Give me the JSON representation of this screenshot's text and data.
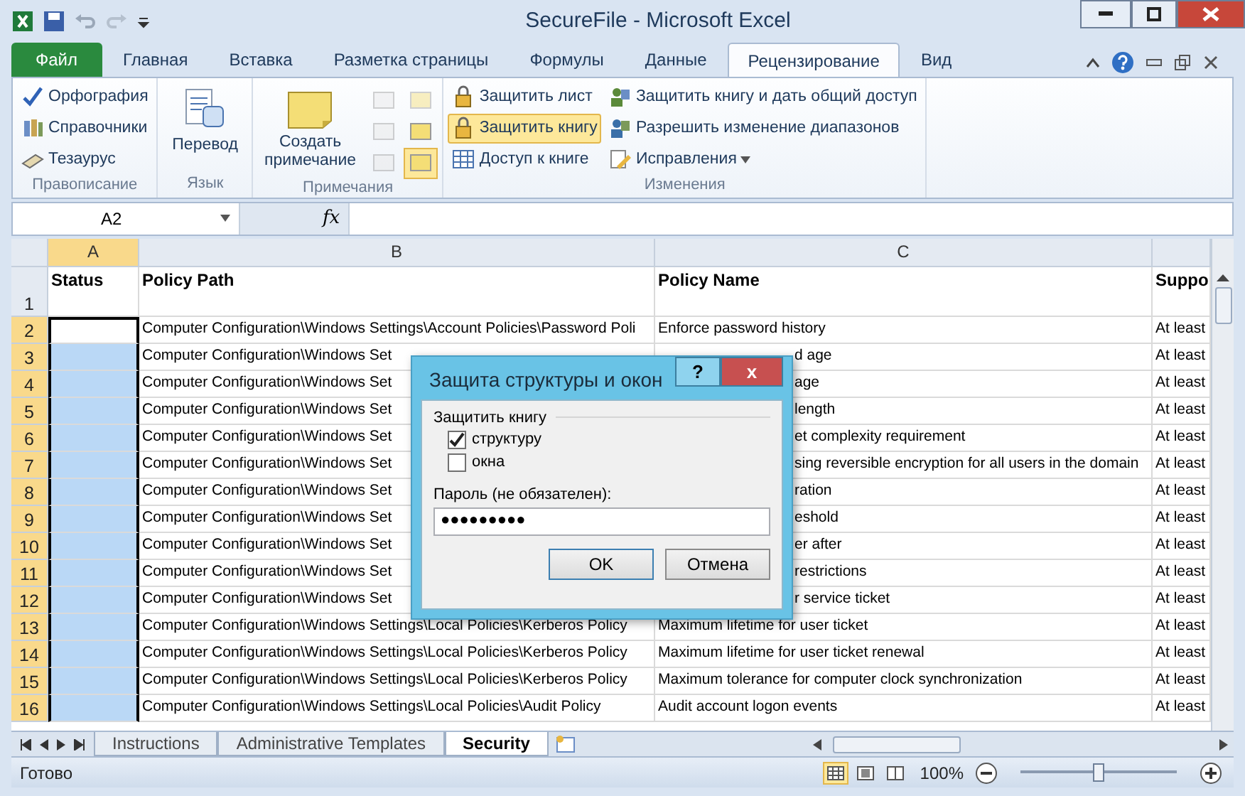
{
  "window": {
    "title": "SecureFile - Microsoft Excel"
  },
  "ribbon_tabs": [
    {
      "label": "Файл",
      "kind": "file",
      "selected": false
    },
    {
      "label": "Главная",
      "kind": "tab",
      "selected": false
    },
    {
      "label": "Вставка",
      "kind": "tab",
      "selected": false
    },
    {
      "label": "Разметка страницы",
      "kind": "tab",
      "selected": false
    },
    {
      "label": "Формулы",
      "kind": "tab",
      "selected": false
    },
    {
      "label": "Данные",
      "kind": "tab",
      "selected": false
    },
    {
      "label": "Рецензирование",
      "kind": "tab",
      "selected": true
    },
    {
      "label": "Вид",
      "kind": "tab",
      "selected": false
    }
  ],
  "ribbon_groups": [
    {
      "label": "Правописание",
      "kind": "list",
      "items": [
        {
          "label": "Орфография",
          "selected": false,
          "has_menu": false
        },
        {
          "label": "Справочники",
          "selected": false,
          "has_menu": false
        },
        {
          "label": "Тезаурус",
          "selected": false,
          "has_menu": false
        }
      ]
    },
    {
      "label": "Язык",
      "kind": "large",
      "items": [
        {
          "label": "Перевод",
          "selected": false,
          "has_menu": false
        }
      ]
    },
    {
      "label": "Примечания",
      "kind": "comments",
      "items": [
        {
          "label": "Создать примечание",
          "selected": false,
          "has_menu": false
        }
      ],
      "tools": [
        {
          "selected": false,
          "disabled": true
        },
        {
          "selected": false,
          "disabled": true
        },
        {
          "selected": false,
          "disabled": true
        },
        {
          "selected": false,
          "disabled": false
        },
        {
          "selected": false,
          "disabled": true
        },
        {
          "selected": true,
          "disabled": false
        }
      ]
    },
    {
      "label": "Изменения",
      "kind": "list",
      "items": [
        {
          "label": "Защитить лист",
          "selected": false,
          "has_menu": false
        },
        {
          "label": "Защитить книгу",
          "selected": true,
          "has_menu": false
        },
        {
          "label": "Доступ к книге",
          "selected": false,
          "has_menu": false
        },
        {
          "label": "Защитить книгу и дать общий доступ",
          "selected": false,
          "has_menu": false
        },
        {
          "label": "Разрешить изменение диапазонов",
          "selected": false,
          "has_menu": false
        },
        {
          "label": "Исправления",
          "selected": false,
          "has_menu": true
        }
      ]
    }
  ],
  "formula_bar": {
    "name_box": "A2",
    "function_label": "fx"
  },
  "columns": [
    {
      "label": "A",
      "selected": true
    },
    {
      "label": "B",
      "selected": false
    },
    {
      "label": "C",
      "selected": false
    }
  ],
  "header_row": {
    "number": "1",
    "selected": false,
    "status": "Status",
    "path": "Policy Path",
    "name": "Policy Name",
    "support": "Suppo"
  },
  "rows": [
    {
      "number": "2",
      "selected": true,
      "active": true,
      "obscured": false,
      "path": "Computer Configuration\\Windows Settings\\Account Policies\\Password Poli",
      "name": "Enforce password history",
      "support": "At least"
    },
    {
      "number": "3",
      "selected": true,
      "active": false,
      "obscured": true,
      "path": "Computer Configuration\\Windows Set",
      "name": "d age",
      "support": "At least"
    },
    {
      "number": "4",
      "selected": true,
      "active": false,
      "obscured": true,
      "path": "Computer Configuration\\Windows Set",
      "name": "age",
      "support": "At least"
    },
    {
      "number": "5",
      "selected": true,
      "active": false,
      "obscured": true,
      "path": "Computer Configuration\\Windows Set",
      "name": "length",
      "support": "At least"
    },
    {
      "number": "6",
      "selected": true,
      "active": false,
      "obscured": true,
      "path": "Computer Configuration\\Windows Set",
      "name": "et complexity requirement",
      "support": "At least"
    },
    {
      "number": "7",
      "selected": true,
      "active": false,
      "obscured": true,
      "path": "Computer Configuration\\Windows Set",
      "name": "sing reversible encryption for all users in the domain",
      "support": "At least"
    },
    {
      "number": "8",
      "selected": true,
      "active": false,
      "obscured": true,
      "path": "Computer Configuration\\Windows Set",
      "name": "ration",
      "support": "At least"
    },
    {
      "number": "9",
      "selected": true,
      "active": false,
      "obscured": true,
      "path": "Computer Configuration\\Windows Set",
      "name": "eshold",
      "support": "At least"
    },
    {
      "number": "10",
      "selected": true,
      "active": false,
      "obscured": true,
      "path": "Computer Configuration\\Windows Set",
      "name": "er after",
      "support": "At least"
    },
    {
      "number": "11",
      "selected": true,
      "active": false,
      "obscured": true,
      "path": "Computer Configuration\\Windows Set",
      "name": "restrictions",
      "support": "At least"
    },
    {
      "number": "12",
      "selected": true,
      "active": false,
      "obscured": true,
      "path": "Computer Configuration\\Windows Set",
      "name": "r service ticket",
      "support": "At least"
    },
    {
      "number": "13",
      "selected": true,
      "active": false,
      "obscured": false,
      "path": "Computer Configuration\\Windows Settings\\Local Policies\\Kerberos Policy",
      "name": "Maximum lifetime for user ticket",
      "support": "At least"
    },
    {
      "number": "14",
      "selected": true,
      "active": false,
      "obscured": false,
      "path": "Computer Configuration\\Windows Settings\\Local Policies\\Kerberos Policy",
      "name": "Maximum lifetime for user ticket renewal",
      "support": "At least"
    },
    {
      "number": "15",
      "selected": true,
      "active": false,
      "obscured": false,
      "path": "Computer Configuration\\Windows Settings\\Local Policies\\Kerberos Policy",
      "name": "Maximum tolerance for computer clock synchronization",
      "support": "At least"
    },
    {
      "number": "16",
      "selected": true,
      "active": false,
      "obscured": false,
      "path": "Computer Configuration\\Windows Settings\\Local Policies\\Audit Policy",
      "name": "Audit account logon events",
      "support": "At least"
    }
  ],
  "dialog": {
    "title": "Защита структуры и окон",
    "help": "?",
    "close": "x",
    "group_label": "Защитить книгу",
    "options": [
      {
        "label": "структуру",
        "checked": true
      },
      {
        "label": "окна",
        "checked": false
      }
    ],
    "password_label": "Пароль (не обязателен):",
    "password_value": "●●●●●●●●●",
    "buttons": [
      {
        "label": "OK",
        "kind": "default"
      },
      {
        "label": "Отмена",
        "kind": "cancel"
      }
    ]
  },
  "sheet_tabs": [
    {
      "label": "Instructions",
      "selected": false
    },
    {
      "label": "Administrative Templates",
      "selected": false
    },
    {
      "label": "Security",
      "selected": true
    }
  ],
  "status_bar": {
    "status": "Готово",
    "views": [
      {
        "selected": true
      },
      {
        "selected": false
      },
      {
        "selected": false
      }
    ],
    "zoom": "100%",
    "zoom_level": {
      "level": 0.5
    }
  }
}
